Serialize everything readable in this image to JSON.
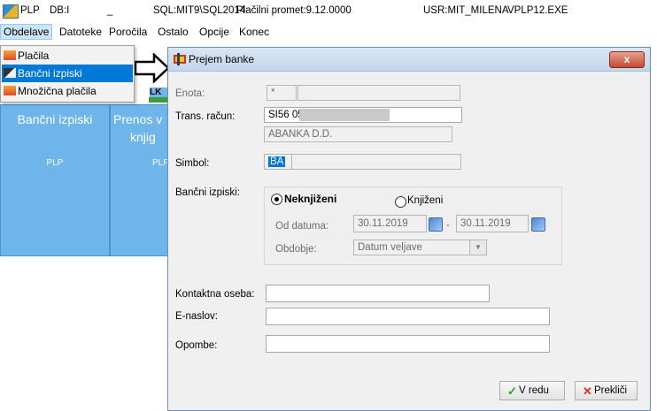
{
  "titlebar": {
    "app": "PLP",
    "db": "DB:I",
    "sep": "_",
    "sql": "SQL:MIT9\\SQL2014",
    "promet": "Plačilni promet:9.12.0000",
    "user": "USR:MIT_MILENA",
    "exe": "VPLP12.EXE"
  },
  "menu": [
    "Obdelave",
    "Datoteke",
    "Poročila",
    "Ostalo",
    "Opcije",
    "Konec"
  ],
  "dropdown": [
    "Plačila",
    "Bančni izpiski",
    "Množična plačila"
  ],
  "tiles": [
    {
      "title": "Bančni izpiski",
      "sub": "PLP"
    },
    {
      "title": "Prenos v",
      "title2": "knjig",
      "sub": "PLP",
      "code": "LK"
    }
  ],
  "dialog": {
    "title": "Prejem banke",
    "close": "x",
    "enota_label": "Enota:",
    "enota_value": "*",
    "trans_label": "Trans. račun:",
    "trans_value": "SI56 05",
    "bank_name": "ABANKA D.D.",
    "simbol_label": "Simbol:",
    "simbol_value": "BA",
    "izpiski_label": "Bančni izpiski:",
    "radio_neknjizeni": "Neknjiženi",
    "radio_knjizeni": "Knjiženi",
    "od_datuma_label": "Od datuma:",
    "date_from": "30.11.2019",
    "date_sep": "-",
    "date_to": "30.11.2019",
    "obdobje_label": "Obdobje:",
    "obdobje_value": "Datum veljave",
    "kontakt_label": "Kontaktna oseba:",
    "email_label": "E-naslov:",
    "opombe_label": "Opombe:",
    "ok_label": "V redu",
    "cancel_label": "Prekliči"
  }
}
